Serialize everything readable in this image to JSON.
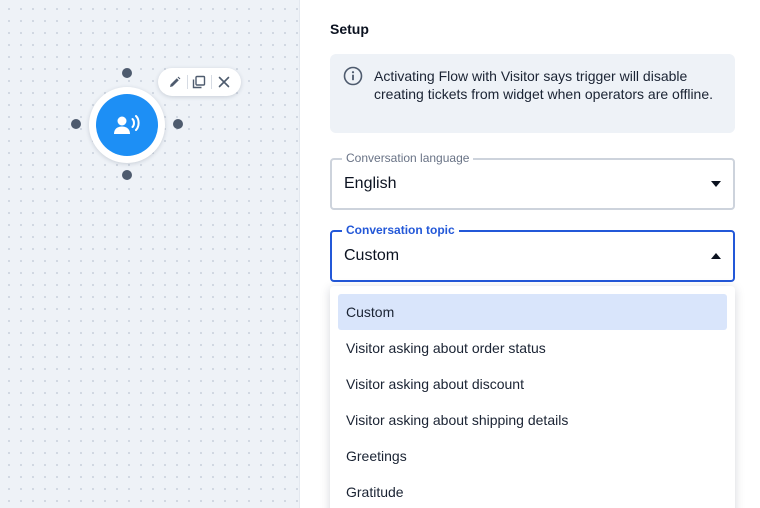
{
  "canvas": {
    "node": {
      "icon": "voice-user-icon",
      "color": "#1d8ff5"
    },
    "toolbar": {
      "icons": [
        "pencil-icon",
        "copy-icon",
        "close-icon"
      ]
    }
  },
  "panel": {
    "title": "Setup",
    "info": {
      "icon": "info-circle-icon",
      "text": "Activating Flow with Visitor says trigger will disable creating tickets from widget when operators are offline."
    },
    "language": {
      "label": "Conversation language",
      "value": "English"
    },
    "topic": {
      "label": "Conversation topic",
      "value": "Custom",
      "options": [
        "Custom",
        "Visitor asking about order status",
        "Visitor asking about discount",
        "Visitor asking about shipping details",
        "Greetings",
        "Gratitude"
      ],
      "selected_index": 0
    }
  },
  "colors": {
    "accent": "#2358d8",
    "selected_bg": "#d9e5fb",
    "canvas_bg": "#eef2f7"
  }
}
